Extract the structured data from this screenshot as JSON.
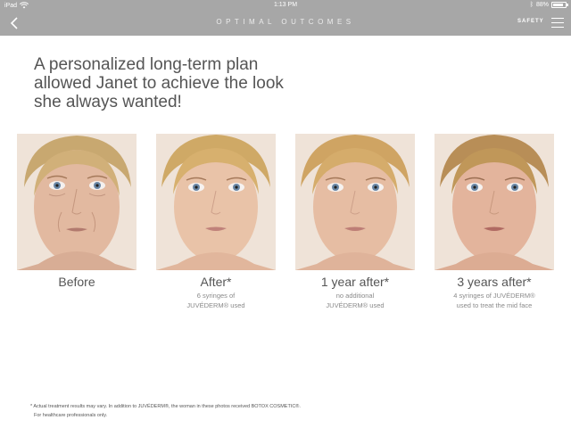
{
  "statusbar": {
    "device": "iPad",
    "time": "1:13 PM",
    "battery_percent": "88%",
    "battery_level": 0.88
  },
  "navbar": {
    "title": "OPTIMAL OUTCOMES",
    "safety_label": "SAFETY"
  },
  "headline": "A personalized long-term plan allowed Janet to achieve the look she always wanted!",
  "photos": [
    {
      "caption": "Before",
      "note_line1": "",
      "note_line2": ""
    },
    {
      "caption": "After*",
      "note_line1": "6 syringes of",
      "note_line2": "JUVÉDERM® used"
    },
    {
      "caption": "1 year after*",
      "note_line1": "no additional",
      "note_line2": "JUVÉDERM® used"
    },
    {
      "caption": "3 years after*",
      "note_line1": "4 syringes of JUVÉDERM®",
      "note_line2": "used to treat the mid face"
    }
  ],
  "footnote": {
    "line1": "* Actual treatment results may vary. In addition to JUVÉDERM®, the woman in these photos received BOTOX COSMETIC®.",
    "line2": "For healthcare professionals only."
  },
  "colors": {
    "bar": "#a7a7a7",
    "text": "#555555",
    "note": "#8a8a8a"
  }
}
